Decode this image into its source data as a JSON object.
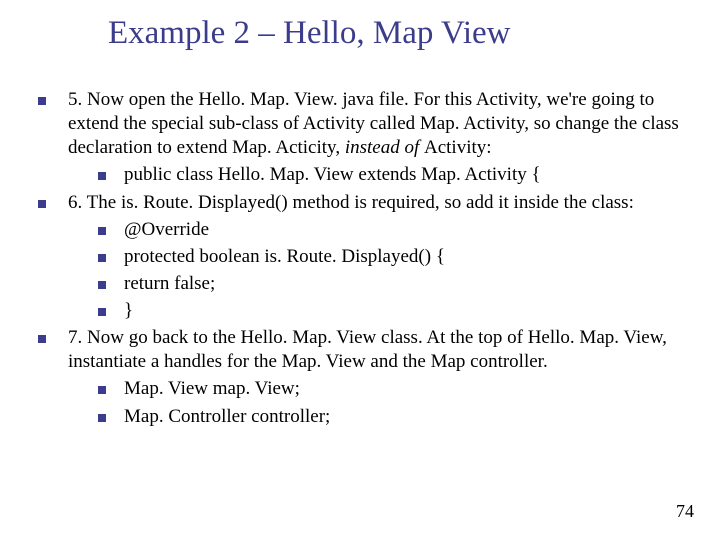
{
  "title": "Example 2 – Hello, Map View",
  "bullets": {
    "b1": "5. Now open the Hello. Map. View. java file. For this Activity, we're going to extend the special sub-class of Activity called  Map. Activity, so change the class declaration to extend  Map. Acticity,  ",
    "b1_ital": "instead of ",
    "b1_tail": "  Activity:",
    "b1a": " public class Hello. Map. View extends Map. Activity {",
    "b2": "6. The  is. Route. Displayed()  method is required, so add it inside the class:",
    "b2a": " @Override",
    "b2b": " protected boolean is. Route. Displayed() {",
    "b2c": "   return false;",
    "b2d": " }",
    "b3": "7.    Now go back to the  Hello. Map. View  class. At the top of Hello. Map. View, instantiate a handles for the Map. View and the Map controller.",
    "b3a": "  Map. View map. View;",
    "b3b": "  Map. Controller controller;"
  },
  "page_number": "74"
}
